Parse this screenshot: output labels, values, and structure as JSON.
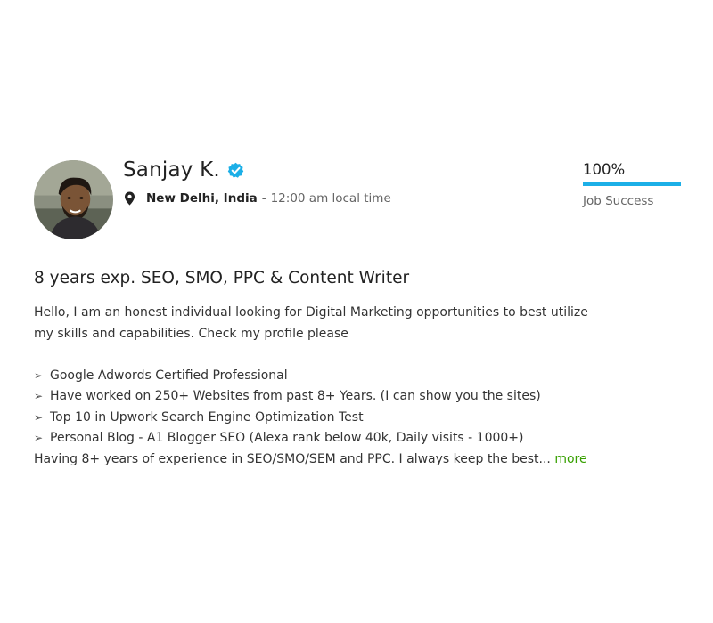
{
  "profile": {
    "name": "Sanjay K.",
    "location_city": "New Delhi, India",
    "location_separator": "-",
    "local_time": "12:00 am local time",
    "job_success": {
      "value": "100%",
      "percent": 100,
      "label": "Job Success",
      "bar_color": "#1cafe7"
    },
    "title": "8 years exp. SEO, SMO, PPC & Content Writer",
    "overview": {
      "intro_line1": "Hello, I am an honest individual looking for Digital Marketing opportunities to best utilize",
      "intro_line2": "my skills and capabilities. Check my profile please",
      "bullet_symbol": "➢",
      "bullets": [
        "Google Adwords Certified Professional",
        "Have worked on 250+ Websites from past 8+ Years. (I can show you the sites)",
        "Top 10 in Upwork Search Engine Optimization Test",
        "Personal Blog - A1 Blogger SEO (Alexa rank below 40k, Daily visits - 1000+)"
      ],
      "closing": "Having 8+ years of experience in SEO/SMO/SEM and PPC. I always keep the best...",
      "more_label": "more"
    }
  },
  "colors": {
    "verified_badge": "#1cafe7",
    "more_link": "#37a000"
  },
  "icons": {
    "verified": "verified-badge-icon",
    "location": "map-pin-icon"
  }
}
